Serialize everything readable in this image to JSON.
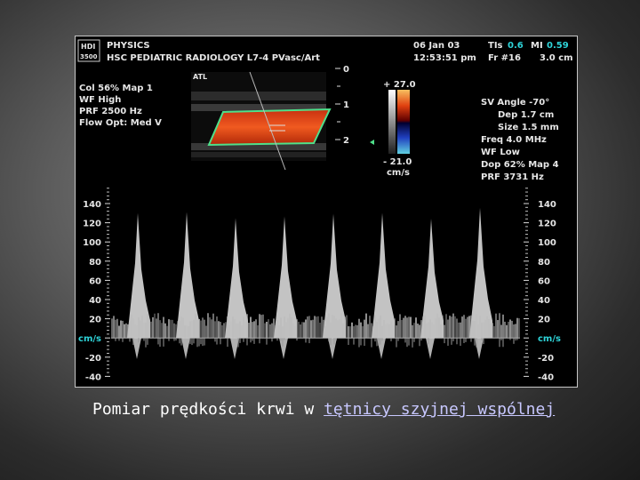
{
  "header": {
    "logo_top": "HDI",
    "logo_bottom": "3500",
    "line1": "PHYSICS",
    "line2": "HSC PEDIATRIC RADIOLOGY L7-4 PVasc/Art",
    "date": "06 Jan 03",
    "time": "12:53:51 pm",
    "tis_label": "TIs",
    "tis_value": "0.6",
    "mi_label": "MI",
    "mi_value": "0.59",
    "frame": "Fr #16",
    "depth": "3.0 cm"
  },
  "left_params": [
    "Col 56%  Map 1",
    "WF High",
    "PRF 2500  Hz",
    "Flow Opt: Med V"
  ],
  "right_params": [
    "SV Angle -70°",
    "Dep 1.7  cm",
    "Size 1.5  mm",
    "Freq 4.0  MHz",
    "WF Low",
    "Dop 62%  Map 4",
    "PRF 3731  Hz"
  ],
  "bmode": {
    "brand": "ATL",
    "depth_marks": [
      "0",
      "1",
      "2"
    ]
  },
  "color_bar": {
    "top": "+ 27.0",
    "bottom": "- 21.0",
    "unit": "cm/s"
  },
  "spectrum": {
    "axis_labels": [
      "140",
      "120",
      "100",
      "80",
      "60",
      "40",
      "20",
      "cm/s",
      "-20",
      "-40"
    ],
    "axis_values": [
      140,
      120,
      100,
      80,
      60,
      40,
      20,
      0,
      -20,
      -40
    ],
    "peak_velocity": 140,
    "beats": 8
  },
  "caption": {
    "prefix": "Pomiar prędkości krwi w ",
    "link": "tętnicy szyjnej wspólnej"
  }
}
